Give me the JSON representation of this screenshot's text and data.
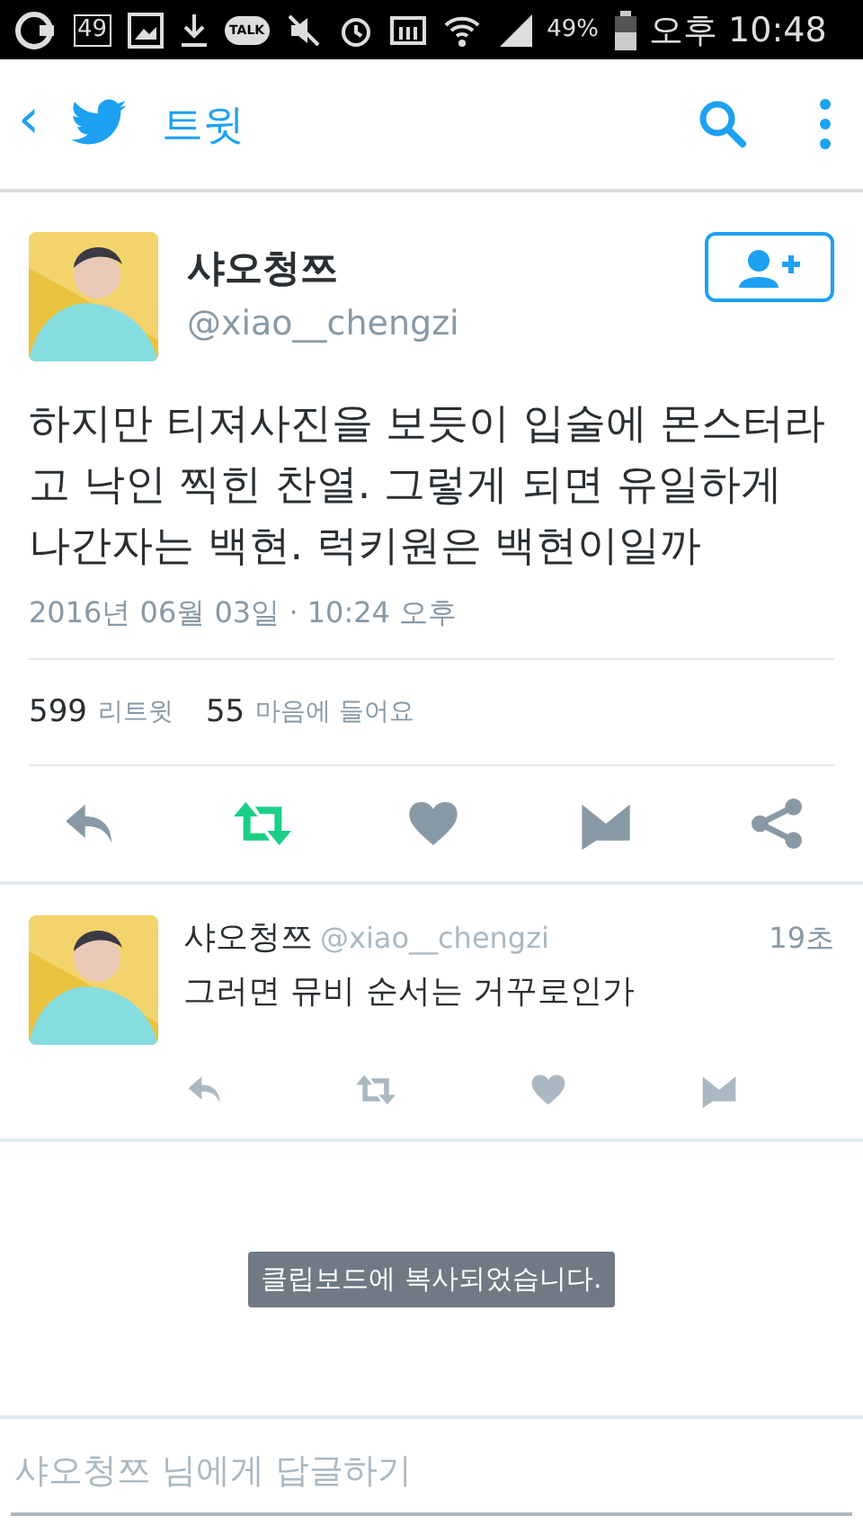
{
  "status_bar": {
    "notification_count": "49",
    "talk_label": "TALK",
    "battery": "49%",
    "time": "오후 10:48"
  },
  "toolbar": {
    "back": "‹",
    "title": "트윗"
  },
  "tweet": {
    "name": "샤오청쯔",
    "handle": "@xiao__chengzi",
    "text": "하지만 티져사진을 보듯이 입술에 몬스터라고 낙인 찍힌 찬열. 그렇게 되면 유일하게 나간자는 백현. 럭키원은 백현이일까",
    "timestamp": "2016년 06월 03일 · 10:24 오후",
    "stats": [
      {
        "count": "599",
        "label": "리트윗"
      },
      {
        "count": "55",
        "label": "마음에 들어요"
      }
    ],
    "actions": [
      {
        "kind": "reply",
        "active": false
      },
      {
        "kind": "retweet",
        "active": true
      },
      {
        "kind": "like",
        "active": false
      },
      {
        "kind": "message",
        "active": false
      },
      {
        "kind": "share",
        "active": false
      }
    ]
  },
  "replies": [
    {
      "name": "샤오청쯔",
      "handle": "@xiao__chengzi",
      "time": "19초",
      "text": "그러면 뮤비 순서는 거꾸로인가",
      "actions": [
        {
          "kind": "reply",
          "active": false
        },
        {
          "kind": "retweet",
          "active": false
        },
        {
          "kind": "like",
          "active": false
        },
        {
          "kind": "message",
          "active": false
        }
      ]
    }
  ],
  "toast": "클립보드에 복사되었습니다.",
  "reply_field": {
    "placeholder": "샤오청쯔 님에게 답글하기"
  }
}
